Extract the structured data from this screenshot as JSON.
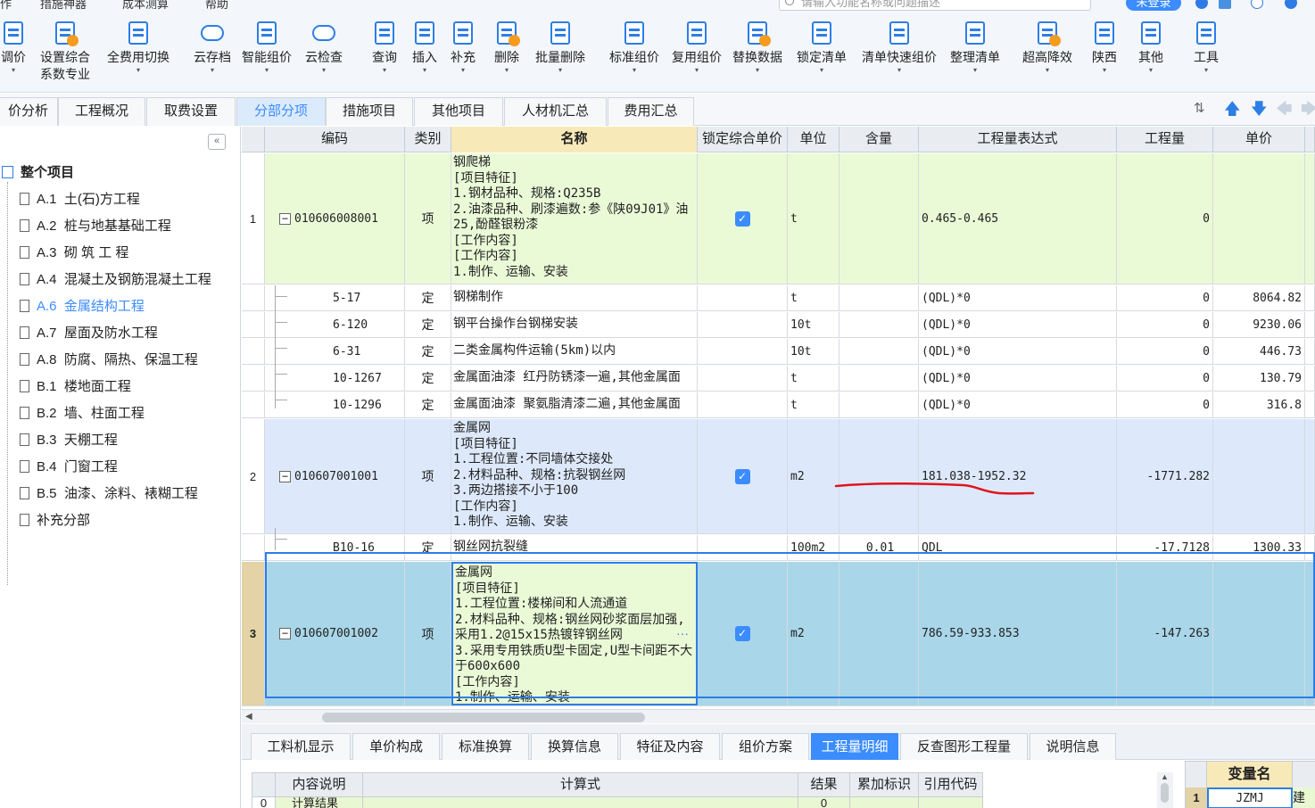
{
  "menu": {
    "items": [
      "作",
      "措施神器",
      "成本测算",
      "帮助"
    ],
    "search_placeholder": "请输入功能名称或问题描述",
    "login": "未登录"
  },
  "toolbar": [
    {
      "label": "调价",
      "sub": "",
      "icon": "price-adjust-icon"
    },
    {
      "label": "设置综合",
      "sub": "系数专业",
      "icon": "coefficient-icon"
    },
    {
      "label": "全费用切换",
      "sub": "",
      "icon": "full-cost-switch-icon"
    },
    {
      "label": "云存档",
      "sub": "",
      "icon": "cloud-save-icon"
    },
    {
      "label": "智能组价",
      "sub": "",
      "icon": "smart-pricing-icon"
    },
    {
      "label": "云检查",
      "sub": "",
      "icon": "cloud-check-icon"
    },
    {
      "label": "查询",
      "sub": "",
      "icon": "query-icon"
    },
    {
      "label": "插入",
      "sub": "",
      "icon": "insert-icon"
    },
    {
      "label": "补充",
      "sub": "",
      "icon": "supplement-icon"
    },
    {
      "label": "删除",
      "sub": "",
      "icon": "delete-icon"
    },
    {
      "label": "批量删除",
      "sub": "",
      "icon": "batch-delete-icon"
    },
    {
      "label": "标准组价",
      "sub": "",
      "icon": "standard-pricing-icon"
    },
    {
      "label": "复用组价",
      "sub": "",
      "icon": "reuse-pricing-icon"
    },
    {
      "label": "替换数据",
      "sub": "",
      "icon": "replace-data-icon"
    },
    {
      "label": "锁定清单",
      "sub": "",
      "icon": "lock-list-icon"
    },
    {
      "label": "清单快速组价",
      "sub": "",
      "icon": "quick-pricing-icon"
    },
    {
      "label": "整理清单",
      "sub": "",
      "icon": "organize-list-icon"
    },
    {
      "label": "超高降效",
      "sub": "",
      "icon": "high-rise-icon"
    },
    {
      "label": "陕西",
      "sub": "",
      "icon": "region-icon"
    },
    {
      "label": "其他",
      "sub": "",
      "icon": "other-icon"
    },
    {
      "label": "工具",
      "sub": "",
      "icon": "tools-icon"
    }
  ],
  "tabs": [
    "价分析",
    "工程概况",
    "取费设置",
    "分部分项",
    "措施项目",
    "其他项目",
    "人材机汇总",
    "费用汇总"
  ],
  "tabs_active": "分部分项",
  "tree": {
    "root": "整个项目",
    "items": [
      {
        "code": "A.1",
        "name": "土(石)方工程"
      },
      {
        "code": "A.2",
        "name": "桩与地基基础工程"
      },
      {
        "code": "A.3",
        "name": "砌 筑 工 程"
      },
      {
        "code": "A.4",
        "name": "混凝土及钢筋混凝土工程"
      },
      {
        "code": "A.6",
        "name": "金属结构工程"
      },
      {
        "code": "A.7",
        "name": "屋面及防水工程"
      },
      {
        "code": "A.8",
        "name": "防腐、隔热、保温工程"
      },
      {
        "code": "B.1",
        "name": "楼地面工程"
      },
      {
        "code": "B.2",
        "name": "墙、柱面工程"
      },
      {
        "code": "B.3",
        "name": "天棚工程"
      },
      {
        "code": "B.4",
        "name": "门窗工程"
      },
      {
        "code": "B.5",
        "name": "油漆、涂料、裱糊工程"
      },
      {
        "code": "",
        "name": "补充分部"
      }
    ],
    "selected": "金属结构工程"
  },
  "grid": {
    "headers": [
      "编码",
      "类别",
      "名称",
      "锁定综合单价",
      "单位",
      "含量",
      "工程量表达式",
      "工程量",
      "单价"
    ],
    "rows": [
      {
        "no": "1",
        "code": "010606008001",
        "type": "项",
        "name": "钢爬梯\n[项目特征]\n1.钢材品种、规格:Q235B\n2.油漆品种、刷漆遍数:参《陕09J01》油25,酚醛银粉漆\n[工作内容]\n[工作内容]\n1.制作、运输、安装",
        "lock": true,
        "unit": "t",
        "content": "",
        "expr": "0.465-0.465",
        "qty": "0",
        "price": ""
      },
      {
        "no": "",
        "code": "5-17",
        "type": "定",
        "name": "钢梯制作",
        "lock": false,
        "unit": "t",
        "content": "",
        "expr": "(QDL)*0",
        "qty": "0",
        "price": "8064.82"
      },
      {
        "no": "",
        "code": "6-120",
        "type": "定",
        "name": "钢平台操作台钢梯安装",
        "lock": false,
        "unit": "10t",
        "content": "",
        "expr": "(QDL)*0",
        "qty": "0",
        "price": "9230.06"
      },
      {
        "no": "",
        "code": "6-31",
        "type": "定",
        "name": "二类金属构件运输(5km)以内",
        "lock": false,
        "unit": "10t",
        "content": "",
        "expr": "(QDL)*0",
        "qty": "0",
        "price": "446.73"
      },
      {
        "no": "",
        "code": "10-1267",
        "type": "定",
        "name": "金属面油漆 红丹防锈漆一遍,其他金属面",
        "lock": false,
        "unit": "t",
        "content": "",
        "expr": "(QDL)*0",
        "qty": "0",
        "price": "130.79"
      },
      {
        "no": "",
        "code": "10-1296",
        "type": "定",
        "name": "金属面油漆 聚氨脂清漆二遍,其他金属面",
        "lock": false,
        "unit": "t",
        "content": "",
        "expr": "(QDL)*0",
        "qty": "0",
        "price": "316.8"
      },
      {
        "no": "2",
        "code": "010607001001",
        "type": "项",
        "name": "金属网\n[项目特征]\n1.工程位置:不同墙体交接处\n2.材料品种、规格:抗裂钢丝网\n3.两边搭接不小于100\n[工作内容]\n1.制作、运输、安装",
        "lock": true,
        "unit": "m2",
        "content": "",
        "expr": "181.038-1952.32",
        "qty": "-1771.282",
        "price": ""
      },
      {
        "no": "",
        "code": "B10-16",
        "type": "定",
        "name": "钢丝网抗裂缝",
        "lock": false,
        "unit": "100m2",
        "content": "0.01",
        "expr": "QDL",
        "qty": "-17.7128",
        "price": "1300.33"
      },
      {
        "no": "3",
        "code": "010607001002",
        "type": "项",
        "name": "金属网\n[项目特征]\n1.工程位置:楼梯间和人流通道\n2.材料品种、规格:钢丝网砂浆面层加强,采用1.2@15x15热镀锌钢丝网\n3.采用专用铁质U型卡固定,U型卡间距不大于600x600\n[工作内容]\n1.制作、运输、安装",
        "lock": true,
        "unit": "m2",
        "content": "",
        "expr": "786.59-933.853",
        "qty": "-147.263",
        "price": ""
      }
    ],
    "ellipsis": "···"
  },
  "bottom_tabs": [
    "工料机显示",
    "单价构成",
    "标准换算",
    "换算信息",
    "特征及内容",
    "组价方案",
    "工程量明细",
    "反查图形工程量",
    "说明信息"
  ],
  "bottom_tabs_active": "工程量明细",
  "detail_table": {
    "headers": [
      "内容说明",
      "计算式",
      "结果",
      "累加标识",
      "引用代码"
    ],
    "first_row": {
      "no": "0",
      "desc": "计算结果",
      "result": "0"
    }
  },
  "var_table": {
    "header": "变量名",
    "row_no": "1",
    "var": "JZMJ",
    "next": "建筑"
  },
  "colors": {
    "accent": "#3b8cff",
    "green_row": "#eafad7",
    "blue_row": "#dde9fb",
    "selected_row": "#a9d6e8",
    "annotation": "#e0141e"
  }
}
